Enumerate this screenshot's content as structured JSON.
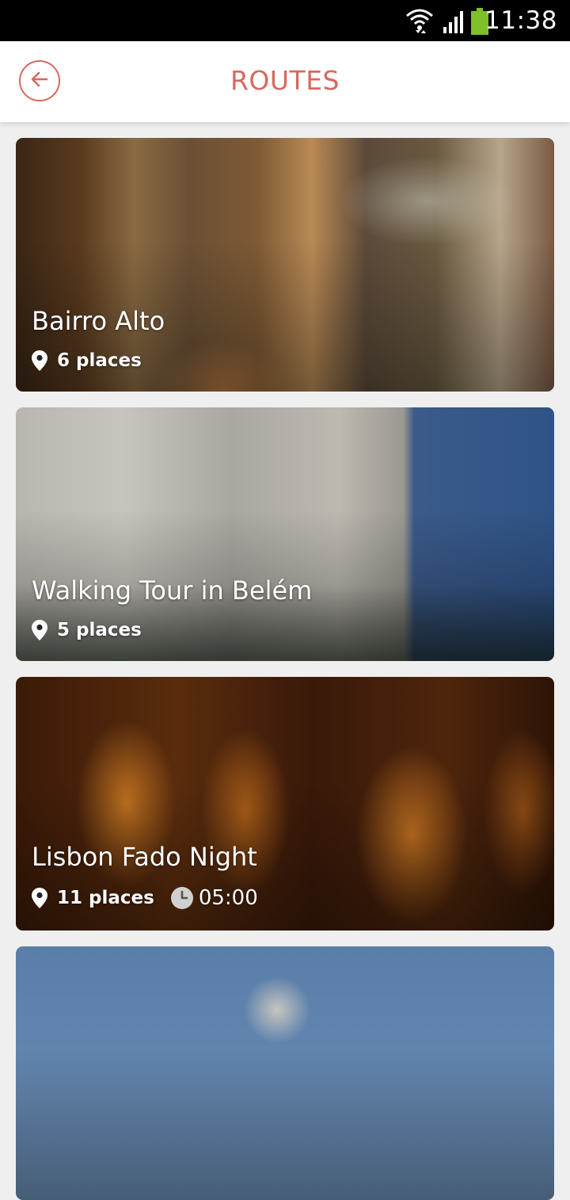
{
  "status_bar": {
    "time": "11:38",
    "icons": [
      "wifi-icon",
      "signal-icon",
      "battery-icon"
    ],
    "battery_color": "#7fbf2a"
  },
  "header": {
    "title": "ROUTES",
    "back_icon": "arrow-left-circle-icon",
    "accent_color": "#d8685f"
  },
  "routes": [
    {
      "title": "Bairro Alto",
      "places": "6 places"
    },
    {
      "title": "Walking Tour in Belém",
      "places": "5 places"
    },
    {
      "title": "Lisbon Fado Night",
      "places": "11 places",
      "duration": "05:00"
    },
    {
      "title": ""
    }
  ]
}
